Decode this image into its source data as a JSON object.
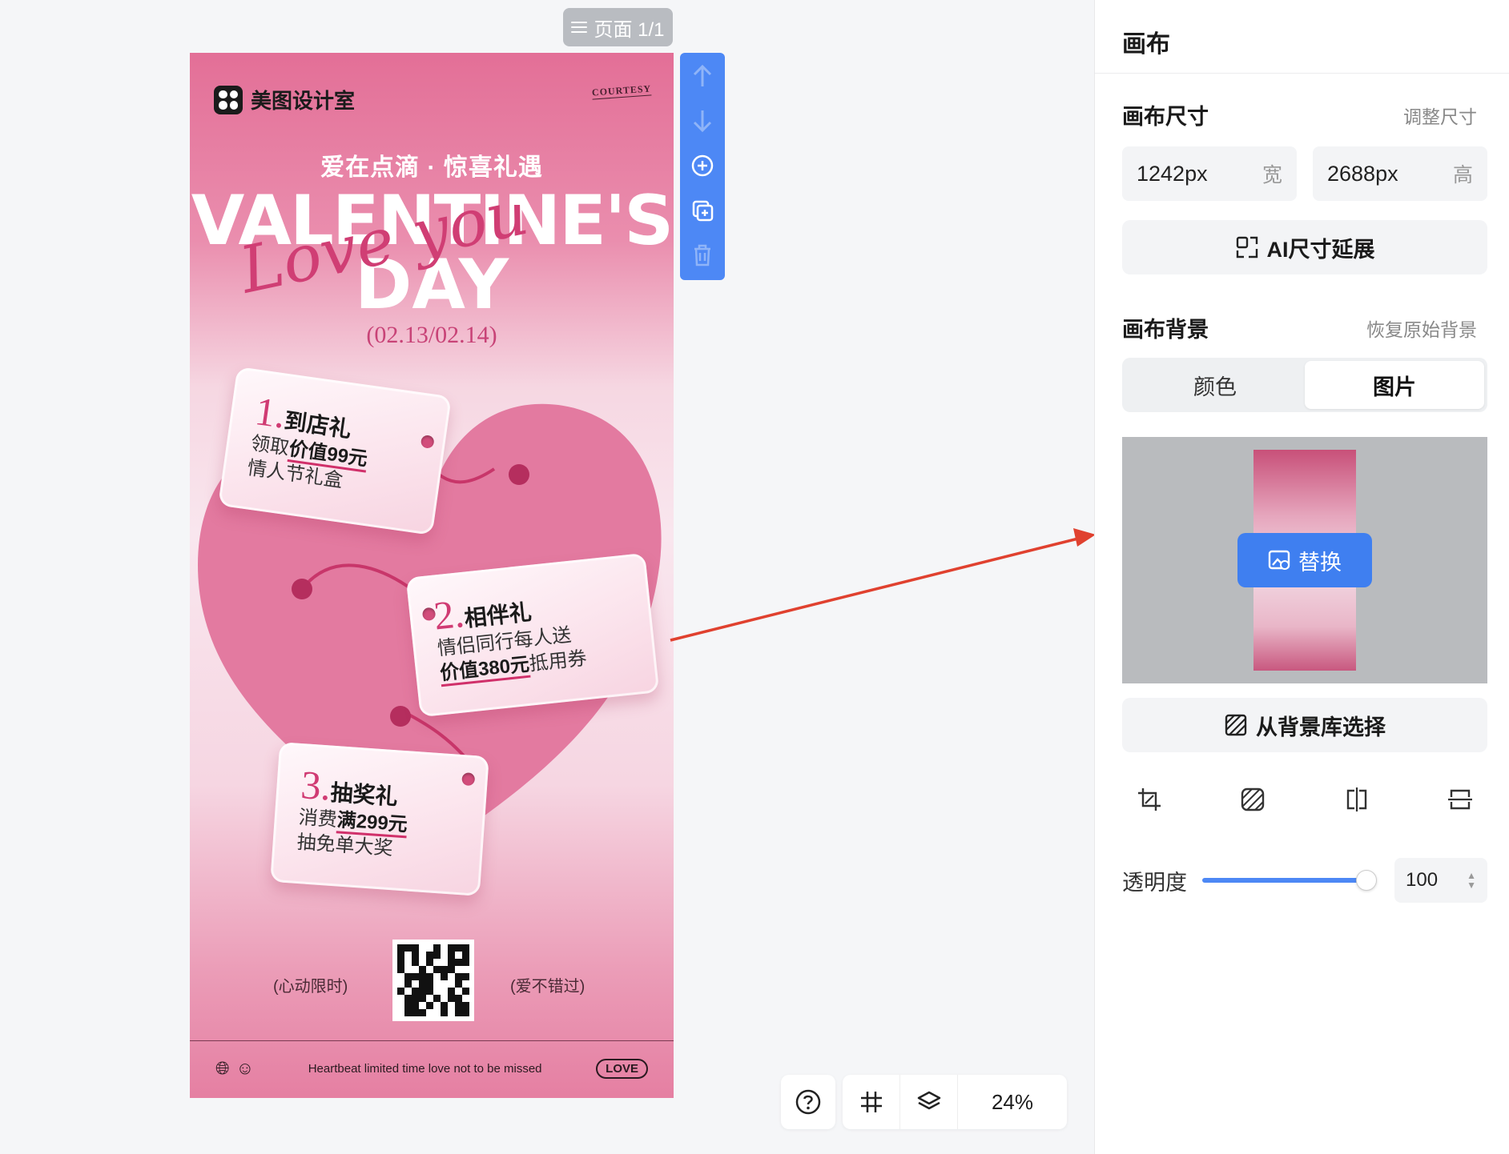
{
  "canvas": {
    "page_indicator": "页面 1/1",
    "zoom": "24%"
  },
  "poster": {
    "brand": "美图设计室",
    "courtesy": "COURTESY",
    "tagline": "爱在点滴 · 惊喜礼遇",
    "title_line1": "VALENTINE'S",
    "title_line2": "DAY",
    "script_text": "Love you",
    "dates": "(02.13/02.14)",
    "gifts": [
      {
        "num": "1.",
        "title": "到店礼",
        "line1_prefix": "领取",
        "line1_em": "价值99元",
        "line2": "情人节礼盒"
      },
      {
        "num": "2.",
        "title": "相伴礼",
        "line1": "情侣同行每人送",
        "line2_em": "价值380元",
        "line2_suffix": "抵用券"
      },
      {
        "num": "3.",
        "title": "抽奖礼",
        "line1_prefix": "消费",
        "line1_em": "满299元",
        "line2": "抽免单大奖"
      }
    ],
    "limit_left": "(心动限时)",
    "limit_right": "(爱不错过)",
    "footer_text": "Heartbeat limited time love not to be missed",
    "footer_badge": "LOVE"
  },
  "panel": {
    "title": "画布",
    "size_section": {
      "heading": "画布尺寸",
      "action": "调整尺寸",
      "width_value": "1242px",
      "width_unit": "宽",
      "height_value": "2688px",
      "height_unit": "高",
      "ai_button": "AI尺寸延展"
    },
    "bg_section": {
      "heading": "画布背景",
      "action": "恢复原始背景",
      "tabs": [
        "颜色",
        "图片"
      ],
      "active_tab": "图片",
      "replace_button": "替换",
      "library_button": "从背景库选择"
    },
    "opacity": {
      "label": "透明度",
      "value": "100",
      "level": 1.0
    }
  },
  "colors": {
    "accent": "#4d88f5",
    "highlight": "#e0412f",
    "poster_pink": "#e36f97"
  }
}
